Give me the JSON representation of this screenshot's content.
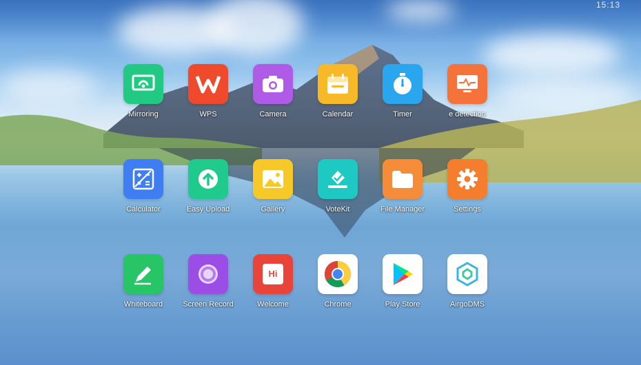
{
  "status": {
    "time": "15:13"
  },
  "apps": [
    {
      "label": "Mirroring",
      "icon": "mirroring-icon",
      "color": "#22c982"
    },
    {
      "label": "WPS",
      "icon": "wps-icon",
      "color": "#f04a2c"
    },
    {
      "label": "Camera",
      "icon": "camera-icon",
      "color": "#b05be8"
    },
    {
      "label": "Calendar",
      "icon": "calendar-icon",
      "color": "#f7b928"
    },
    {
      "label": "Timer",
      "icon": "timer-icon",
      "color": "#2aa6ef"
    },
    {
      "label": "e detection",
      "icon": "monitor-detection-icon",
      "color": "#f5733a"
    },
    {
      "label": "Calculator",
      "icon": "calculator-icon",
      "color": "#3f7df2"
    },
    {
      "label": "Easy Upload",
      "icon": "upload-icon",
      "color": "#20c98c"
    },
    {
      "label": "Gallery",
      "icon": "gallery-icon",
      "color": "#f6c928"
    },
    {
      "label": "VoteKit",
      "icon": "vote-icon",
      "color": "#1ec9c4"
    },
    {
      "label": "File Manager",
      "icon": "folder-icon",
      "color": "#f58c3a"
    },
    {
      "label": "Settings",
      "icon": "gear-icon",
      "color": "#f57d2e"
    },
    {
      "label": "Whiteboard",
      "icon": "pen-icon",
      "color": "#27c565"
    },
    {
      "label": "Screen Record",
      "icon": "record-icon",
      "color": "#9a4ee6"
    },
    {
      "label": "Welcome",
      "icon": "welcome-icon",
      "color": "#e9443a",
      "glyph": "Hi"
    },
    {
      "label": "Chrome",
      "icon": "chrome-icon",
      "color": "#ffffff"
    },
    {
      "label": "Play Store",
      "icon": "play-store-icon",
      "color": "#ffffff"
    },
    {
      "label": "AirgoDMS",
      "icon": "airgodms-icon",
      "color": "#ffffff"
    }
  ]
}
